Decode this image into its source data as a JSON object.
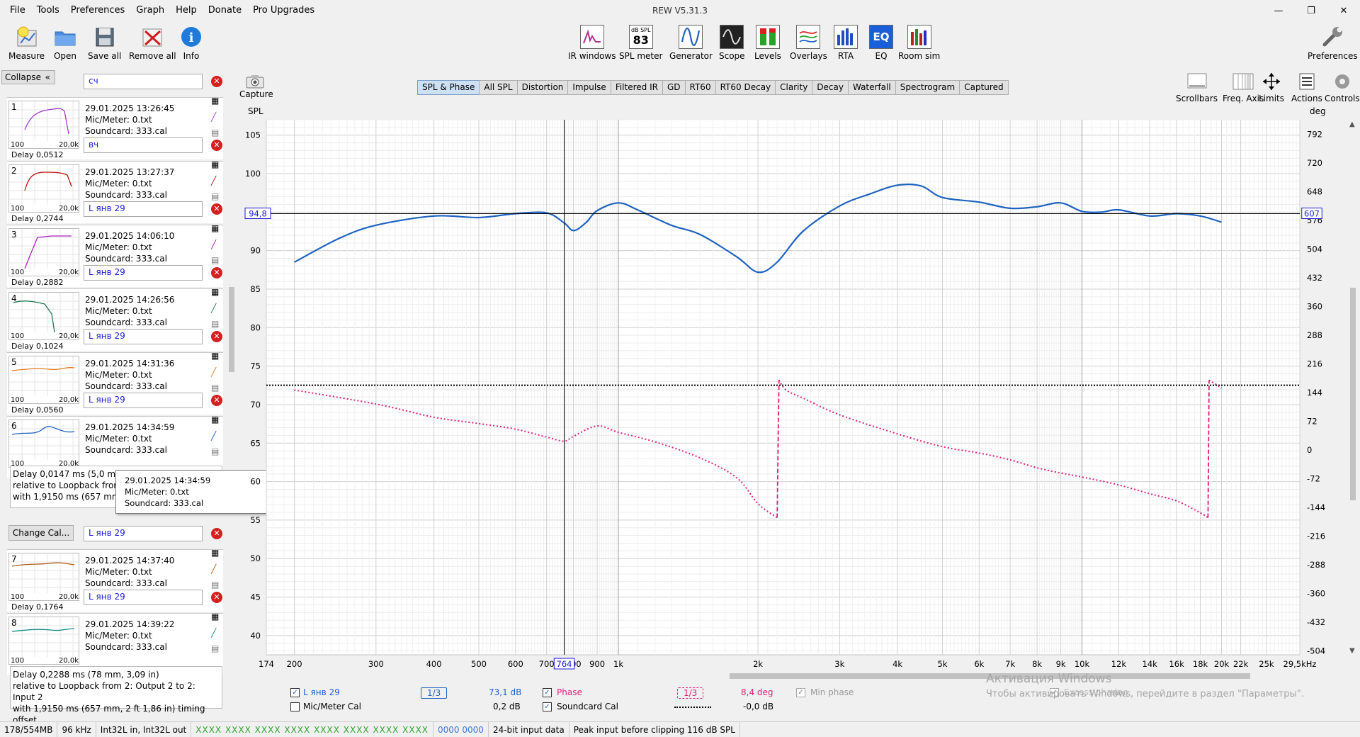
{
  "window": {
    "title": "REW V5.31.3",
    "minimize": "—",
    "maximize": "❐",
    "close": "✕"
  },
  "menu": [
    "File",
    "Tools",
    "Preferences",
    "Graph",
    "Help",
    "Donate",
    "Pro Upgrades"
  ],
  "toolbar_left": [
    {
      "label": "Measure",
      "icon": "measure-icon"
    },
    {
      "label": "Open",
      "icon": "folder-icon"
    },
    {
      "label": "Save all",
      "icon": "save-icon"
    },
    {
      "label": "Remove all",
      "icon": "remove-icon"
    },
    {
      "label": "Info",
      "icon": "info-icon"
    }
  ],
  "toolbar_center": [
    {
      "label": "IR windows",
      "icon": "ir-windows-icon"
    },
    {
      "label": "SPL meter",
      "icon": "spl-meter-icon",
      "top": "dB SPL",
      "value": "83"
    },
    {
      "label": "Generator",
      "icon": "generator-icon"
    },
    {
      "label": "Scope",
      "icon": "scope-icon"
    },
    {
      "label": "Levels",
      "icon": "levels-icon"
    },
    {
      "label": "Overlays",
      "icon": "overlays-icon"
    },
    {
      "label": "RTA",
      "icon": "rta-icon"
    },
    {
      "label": "EQ",
      "icon": "eq-icon"
    },
    {
      "label": "Room sim",
      "icon": "room-sim-icon"
    }
  ],
  "toolbar_right": {
    "label": "Preferences",
    "icon": "wrench-icon"
  },
  "left_panel": {
    "collapse_label": "Collapse",
    "collapse_icon": "«",
    "change_cal_label": "Change Cal...",
    "measurements": [
      {
        "num": "1",
        "name": "сч",
        "date": "29.01.2025 13:26:45",
        "mic": "Mic/Meter: 0.txt",
        "card": "Soundcard: 333.cal",
        "color": "#a43cc8",
        "axis_lo": "100",
        "axis_hi": "20,0k",
        "peek": "Delay 0,0512"
      },
      {
        "num": "2",
        "name": "вч",
        "date": "29.01.2025 13:27:37",
        "mic": "Mic/Meter: 0.txt",
        "card": "Soundcard: 333.cal",
        "color": "#c01010",
        "axis_lo": "100",
        "axis_hi": "20,0k",
        "peek": "Delay 0,2744"
      },
      {
        "num": "3",
        "name": "L янв 29",
        "date": "29.01.2025 14:06:10",
        "mic": "Mic/Meter: 0.txt",
        "card": "Soundcard: 333.cal",
        "color": "#b020c0",
        "axis_lo": "100",
        "axis_hi": "20,0k",
        "peek": "Delay 0,2882"
      },
      {
        "num": "4",
        "name": "L янв 29",
        "date": "29.01.2025 14:26:56",
        "mic": "Mic/Meter: 0.txt",
        "card": "Soundcard: 333.cal",
        "color": "#1a7a50",
        "axis_lo": "100",
        "axis_hi": "20,0k",
        "peek": "Delay 0,1024"
      },
      {
        "num": "5",
        "name": "L янв 29",
        "date": "29.01.2025 14:31:36",
        "mic": "Mic/Meter: 0.txt",
        "card": "Soundcard: 333.cal",
        "color": "#e07a20",
        "axis_lo": "100",
        "axis_hi": "20,0k",
        "peek": "Delay 0,0560"
      },
      {
        "num": "6",
        "name": "L янв 29",
        "date": "29.01.2025 14:34:59",
        "mic": "Mic/Meter: 0.txt",
        "card": "Soundcard: 333.cal",
        "color": "#1f63c0",
        "axis_lo": "100",
        "axis_hi": "20,0k",
        "peek": ""
      },
      {
        "num": "7",
        "name": "L янв 29",
        "date": "29.01.2025 14:37:40",
        "mic": "Mic/Meter: 0.txt",
        "card": "Soundcard: 333.cal",
        "color": "#b05a10",
        "axis_lo": "100",
        "axis_hi": "20,0k",
        "peek": "Delay 0,1764"
      },
      {
        "num": "8",
        "name": "L янв 29",
        "date": "29.01.2025 14:39:22",
        "mic": "Mic/Meter: 0.txt",
        "card": "Soundcard: 333.cal",
        "color": "#1a8a8a",
        "axis_lo": "100",
        "axis_hi": "20,0k",
        "peek": ""
      }
    ],
    "delay6": [
      "Delay 0,0147 ms (5,0 mm, 0,",
      " relative to Loopback from 2",
      "with 1,9150 ms (657 mm, 2 ft"
    ],
    "delay8": [
      "Delay 0,2288 ms (78 mm, 3,09 in)",
      " relative to Loopback from 2: Output 2 to 2: Input 2",
      "with 1,9150 ms (657 mm, 2 ft 1,86 in) timing offset"
    ],
    "tooltip": [
      "29.01.2025 14:34:59",
      "Mic/Meter: 0.txt",
      "Soundcard: 333.cal"
    ]
  },
  "graph_toolbar": {
    "capture_label": "Capture",
    "tabs": [
      "SPL & Phase",
      "All SPL",
      "Distortion",
      "Impulse",
      "Filtered IR",
      "GD",
      "RT60",
      "RT60 Decay",
      "Clarity",
      "Decay",
      "Waterfall",
      "Spectrogram",
      "Captured"
    ],
    "selected_tab": "SPL & Phase",
    "right_buttons": [
      {
        "label": "Scrollbars",
        "icon": "scrollbars-icon"
      },
      {
        "label": "Freq. Axis",
        "icon": "freq-axis-icon"
      },
      {
        "label": "Limits",
        "icon": "limits-icon"
      },
      {
        "label": "Actions",
        "icon": "actions-icon"
      },
      {
        "label": "Controls",
        "icon": "controls-icon"
      }
    ]
  },
  "chart_data": {
    "type": "line",
    "ylabel": "SPL",
    "y2label": "deg",
    "xscale": "log",
    "xlim": [
      174,
      29500
    ],
    "ylim": [
      37.5,
      107
    ],
    "y2lim": [
      -514,
      828
    ],
    "yticks": [
      "105",
      "100",
      "95",
      "90",
      "85",
      "80",
      "75",
      "70",
      "65",
      "60",
      "55",
      "50",
      "45",
      "40"
    ],
    "y2ticks": [
      "792",
      "720",
      "648",
      "576",
      "504",
      "432",
      "360",
      "288",
      "216",
      "144",
      "72",
      "0",
      "-72",
      "-144",
      "-216",
      "-288",
      "-360",
      "-432",
      "-504"
    ],
    "xticks": [
      "174",
      "200",
      "300",
      "400",
      "500",
      "600",
      "700",
      "800",
      "900",
      "1k",
      "2k",
      "3k",
      "4k",
      "5k",
      "6k",
      "7k",
      "8k",
      "9k",
      "10k",
      "12k",
      "14k",
      "16k",
      "18k",
      "20k",
      "22k",
      "25k",
      "29,5kHz"
    ],
    "cursor": {
      "x_label": "764",
      "y_left_label": "94,8",
      "y_right_label": "607"
    },
    "hline_phase_deg": 162,
    "series": [
      {
        "name": "L янв 29",
        "axis": "left",
        "color": "#1f63c0",
        "x": [
          200,
          250,
          300,
          400,
          500,
          600,
          700,
          764,
          800,
          850,
          900,
          1000,
          1100,
          1300,
          1500,
          1800,
          2000,
          2200,
          2500,
          3000,
          3500,
          4000,
          4500,
          5000,
          6000,
          7000,
          8000,
          9000,
          10000,
          11000,
          12000,
          14000,
          16000,
          18000,
          20000
        ],
        "y": [
          88.5,
          91.6,
          93.3,
          94.5,
          94.3,
          94.8,
          94.9,
          93.6,
          92.6,
          93.6,
          95.2,
          96.2,
          95.3,
          93.3,
          92.1,
          89.2,
          87.2,
          88.5,
          92.5,
          95.8,
          97.4,
          98.5,
          98.4,
          96.9,
          96.3,
          95.5,
          95.7,
          96.2,
          95.1,
          95.0,
          95.3,
          94.5,
          94.8,
          94.5,
          93.7
        ]
      },
      {
        "name": "Phase",
        "axis": "right",
        "color": "#e0207a",
        "x": [
          200,
          300,
          400,
          500,
          600,
          700,
          764,
          800,
          900,
          1000,
          1200,
          1500,
          1800,
          2000,
          2200,
          2220,
          2300,
          2500,
          3000,
          4000,
          5000,
          6000,
          7000,
          8000,
          9000,
          10000,
          12000,
          14000,
          16000,
          18000,
          18700,
          18800,
          20000
        ],
        "y": [
          150,
          115,
          82,
          66,
          52,
          32,
          22,
          34,
          60,
          44,
          20,
          -20,
          -70,
          -135,
          -170,
          175,
          150,
          130,
          88,
          40,
          8,
          -8,
          -25,
          -45,
          -58,
          -68,
          -88,
          -110,
          -128,
          -158,
          -170,
          175,
          155
        ]
      }
    ]
  },
  "legend": {
    "spl_name": "L янв 29",
    "spl_smooth": "1/3",
    "spl_value": "73,1 dB",
    "mic_cal": "Mic/Meter Cal",
    "mic_value": "0,2 dB",
    "phase_name": "Phase",
    "phase_smooth": "1/3",
    "phase_value": "8,4 deg",
    "min_phase": "Min phase",
    "excess_phase": "Excess phase",
    "soundcard_cal": "Soundcard Cal",
    "sc_value": "-0,0 dB",
    "excess_value": "deg",
    "check": "✓"
  },
  "activation": {
    "title": "Активация Windows",
    "subtitle": "Чтобы активировать Windows, перейдите в раздел \"Параметры\"."
  },
  "status_bar": [
    "178/554MB",
    "96 kHz",
    "Int32L in, Int32L out",
    "XXXX XXXX  XXXX XXXX  XXXX XXXX  XXXX XXXX",
    "0000 0000",
    "24-bit input data",
    "Peak input before clipping 116 dB SPL"
  ]
}
